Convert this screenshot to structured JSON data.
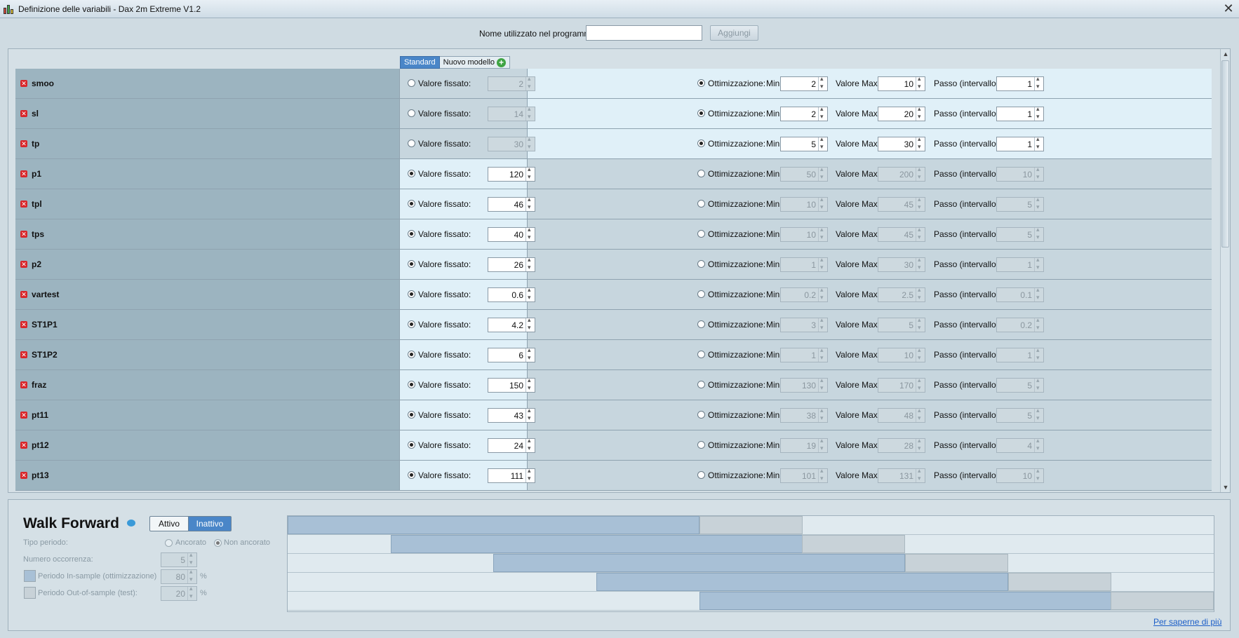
{
  "window": {
    "title": "Definizione delle variabili - Dax 2m Extreme V1.2",
    "close_glyph": "✕"
  },
  "top": {
    "name_label": "Nome utilizzato nel programma",
    "name_value": "",
    "add_label": "Aggiungi"
  },
  "tabs": [
    {
      "label": "Standard",
      "active": true
    },
    {
      "label": "Nuovo modello",
      "active": false
    }
  ],
  "labels": {
    "fixed": "Valore fissato:",
    "opt": "Ottimizzazione:",
    "min": "Min",
    "max": "Valore Max",
    "step": "Passo (intervallo)"
  },
  "variables": [
    {
      "name": "smoo",
      "mode": "opt",
      "fixed": "2",
      "min": "2",
      "max": "10",
      "step": "1"
    },
    {
      "name": "sl",
      "mode": "opt",
      "fixed": "14",
      "min": "2",
      "max": "20",
      "step": "1"
    },
    {
      "name": "tp",
      "mode": "opt",
      "fixed": "30",
      "min": "5",
      "max": "30",
      "step": "1"
    },
    {
      "name": "p1",
      "mode": "fixed",
      "fixed": "120",
      "min": "50",
      "max": "200",
      "step": "10"
    },
    {
      "name": "tpl",
      "mode": "fixed",
      "fixed": "46",
      "min": "10",
      "max": "45",
      "step": "5"
    },
    {
      "name": "tps",
      "mode": "fixed",
      "fixed": "40",
      "min": "10",
      "max": "45",
      "step": "5"
    },
    {
      "name": "p2",
      "mode": "fixed",
      "fixed": "26",
      "min": "1",
      "max": "30",
      "step": "1"
    },
    {
      "name": "vartest",
      "mode": "fixed",
      "fixed": "0.6",
      "min": "0.2",
      "max": "2.5",
      "step": "0.1"
    },
    {
      "name": "ST1P1",
      "mode": "fixed",
      "fixed": "4.2",
      "min": "3",
      "max": "5",
      "step": "0.2"
    },
    {
      "name": "ST1P2",
      "mode": "fixed",
      "fixed": "6",
      "min": "1",
      "max": "10",
      "step": "1"
    },
    {
      "name": "fraz",
      "mode": "fixed",
      "fixed": "150",
      "min": "130",
      "max": "170",
      "step": "5"
    },
    {
      "name": "pt11",
      "mode": "fixed",
      "fixed": "43",
      "min": "38",
      "max": "48",
      "step": "5"
    },
    {
      "name": "pt12",
      "mode": "fixed",
      "fixed": "24",
      "min": "19",
      "max": "28",
      "step": "4"
    },
    {
      "name": "pt13",
      "mode": "fixed",
      "fixed": "111",
      "min": "101",
      "max": "131",
      "step": "10"
    }
  ],
  "walk_forward": {
    "title": "Walk Forward",
    "toggle": {
      "on_label": "Attivo",
      "off_label": "Inattivo",
      "selected": "Inattivo"
    },
    "period_type_label": "Tipo periodo:",
    "period_options": [
      {
        "label": "Ancorato",
        "selected": false
      },
      {
        "label": "Non ancorato",
        "selected": true
      }
    ],
    "occurrences_label": "Numero occorrenza:",
    "occurrences_value": "5",
    "in_sample_label": "Periodo In-sample (ottimizzazione)",
    "in_sample_value": "80",
    "out_sample_label": "Periodo Out-of-sample (test):",
    "out_sample_value": "20",
    "percent": "%",
    "colors": {
      "in_sample": "#a8c0d6",
      "out_of_sample": "#c8d2d8"
    },
    "schedule": [
      {
        "in_start": 0.0,
        "in_end": 0.4444,
        "out_end": 0.5556
      },
      {
        "in_start": 0.1111,
        "in_end": 0.5556,
        "out_end": 0.6667
      },
      {
        "in_start": 0.2222,
        "in_end": 0.6667,
        "out_end": 0.7778
      },
      {
        "in_start": 0.3333,
        "in_end": 0.7778,
        "out_end": 0.8889
      },
      {
        "in_start": 0.4444,
        "in_end": 0.8889,
        "out_end": 1.0
      }
    ],
    "more_link": "Per saperne di più"
  }
}
